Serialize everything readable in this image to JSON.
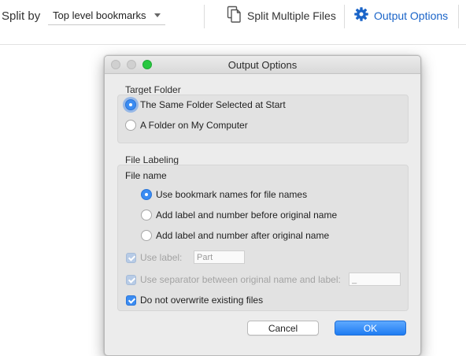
{
  "toolbar": {
    "split_by_label": "Split by",
    "split_by_value": "Top level bookmarks",
    "split_multiple_label": "Split Multiple Files",
    "output_options_label": "Output Options",
    "split_multiple_icon": "documents-icon",
    "output_options_icon": "gear-icon"
  },
  "dialog": {
    "title": "Output Options",
    "target_folder": {
      "label": "Target Folder",
      "options": [
        {
          "label": "The Same Folder Selected at Start",
          "selected": true
        },
        {
          "label": "A Folder on My Computer",
          "selected": false
        }
      ]
    },
    "file_labeling": {
      "label": "File Labeling",
      "file_name_heading": "File name",
      "options": [
        {
          "label": "Use bookmark names for file names",
          "selected": true
        },
        {
          "label": "Add label and number before original name",
          "selected": false
        },
        {
          "label": "Add label and number after original name",
          "selected": false
        }
      ],
      "use_label": {
        "label": "Use label:",
        "checked": true,
        "enabled": false,
        "value": "Part"
      },
      "use_separator": {
        "label": "Use separator between original name and label:",
        "checked": true,
        "enabled": false,
        "value": "_"
      },
      "no_overwrite": {
        "label": "Do not overwrite existing files",
        "checked": true,
        "enabled": true
      }
    },
    "cancel_label": "Cancel",
    "ok_label": "OK"
  },
  "colors": {
    "accent": "#1a64c8",
    "primary_button": "#1f7cf2",
    "dialog_background": "#ececec",
    "window_zoom_button": "#28c840"
  }
}
